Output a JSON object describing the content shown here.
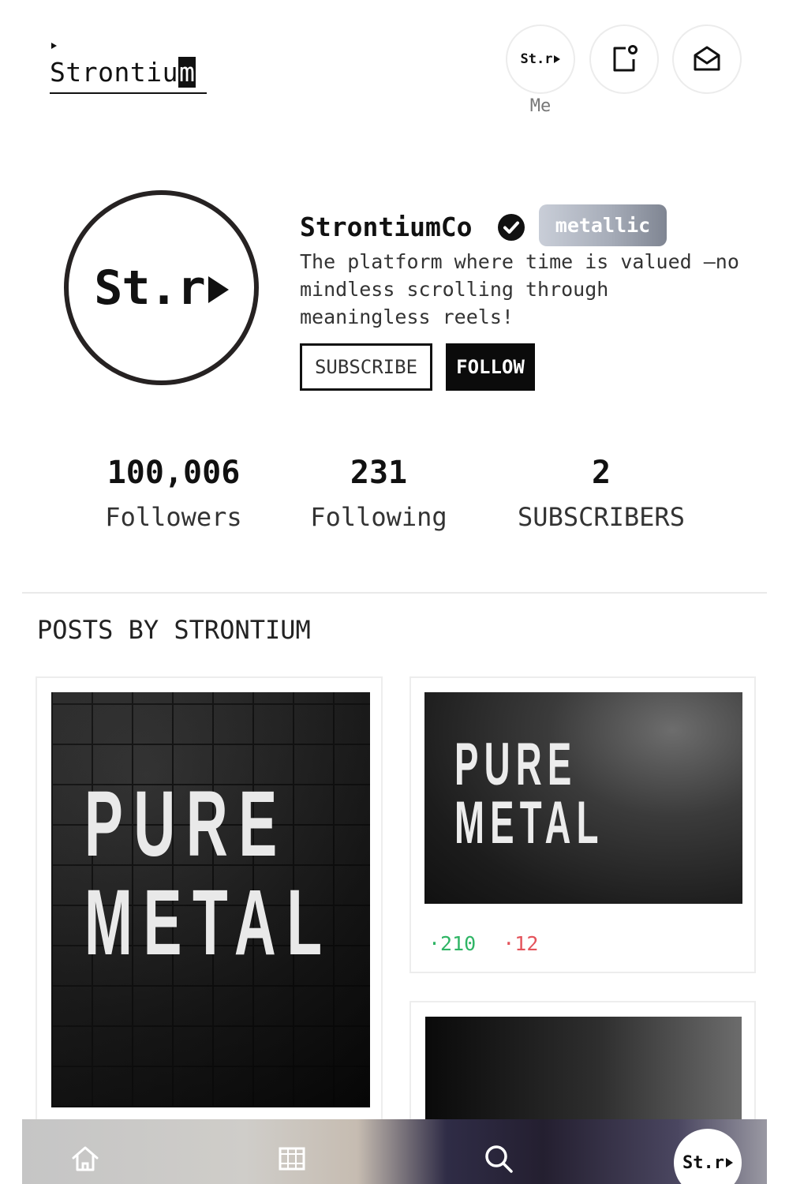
{
  "header": {
    "logo": {
      "main": "Strontiu",
      "last": "m"
    },
    "me_button": {
      "mark": "St.r",
      "label": "Me",
      "icon": "play-triangle-icon"
    },
    "note_icon": "notification-note-icon",
    "mail_icon": "mail-open-icon"
  },
  "profile": {
    "avatar_text": "St.r",
    "handle": "StrontiumCo",
    "verified_icon": "verified-check-icon",
    "badge": "metallic",
    "badge_colors": [
      "#c9ced8",
      "#7f8592"
    ],
    "bio": "The platform where time is valued —no mindless scrolling through meaningless reels!",
    "subscribe_label": "SUBSCRIBE",
    "follow_label": "FOLLOW"
  },
  "stats": [
    {
      "value": "100,006",
      "label": "Followers"
    },
    {
      "value": "231",
      "label": "Following"
    },
    {
      "value": "2",
      "label": "SUBSCRIBERS"
    }
  ],
  "posts_section": {
    "title": "POSTS BY STRONTIUM",
    "posts": [
      {
        "image_text": "PURE\nMETAL"
      },
      {
        "image_text": "PURE\nMETAL",
        "upvotes": "·210",
        "downvotes": "·12",
        "up_color": "#2fb565",
        "down_color": "#e4535b"
      },
      {
        "image_text": ""
      }
    ]
  },
  "bottom_nav": {
    "items": [
      "home-icon",
      "grid-icon",
      "search-icon"
    ],
    "me_mark": "St.r"
  }
}
